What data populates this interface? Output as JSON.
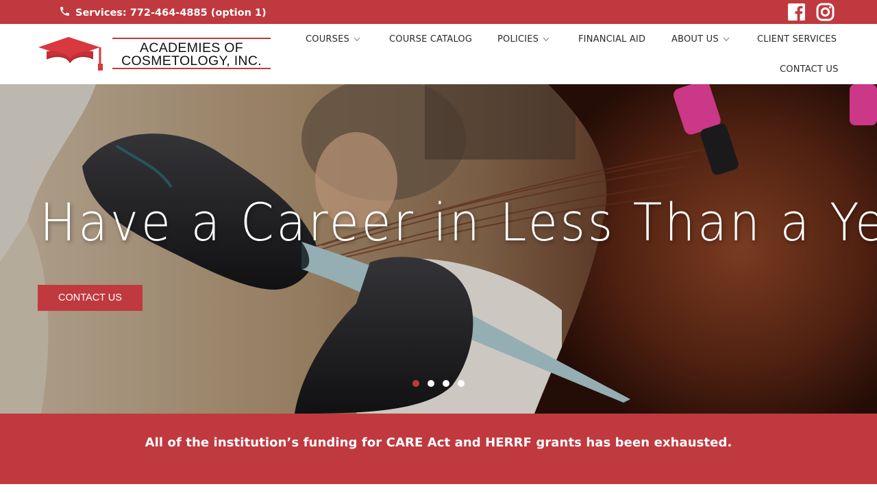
{
  "topbar": {
    "phone_text": "Services: 772-464-4885 (option 1)",
    "icons": [
      "phone-icon",
      "facebook-icon",
      "instagram-icon"
    ],
    "color": "#c0393e"
  },
  "logo": {
    "line1": "ACADEMIES OF",
    "line2": "COSMETOLOGY, INC.",
    "icon": "graduation-cap-icon"
  },
  "nav": {
    "items": [
      {
        "label": "COURSES",
        "has_dropdown": true
      },
      {
        "label": "COURSE CATALOG",
        "has_dropdown": false
      },
      {
        "label": "POLICIES",
        "has_dropdown": true
      },
      {
        "label": "FINANCIAL AID",
        "has_dropdown": false
      },
      {
        "label": "ABOUT US",
        "has_dropdown": true
      },
      {
        "label": "CLIENT SERVICES",
        "has_dropdown": false
      },
      {
        "label": "CONTACT US",
        "has_dropdown": false
      }
    ]
  },
  "hero": {
    "title": "Have a Career in Less Than a Year!",
    "button_label": "CONTACT US",
    "slides": 4,
    "active_slide": 1
  },
  "banner": {
    "text": "All of the institution’s funding for CARE Act and HERRF grants has been exhausted."
  },
  "colors": {
    "accent": "#c0393e",
    "text_dark": "#2a2a2a",
    "white": "#ffffff"
  }
}
